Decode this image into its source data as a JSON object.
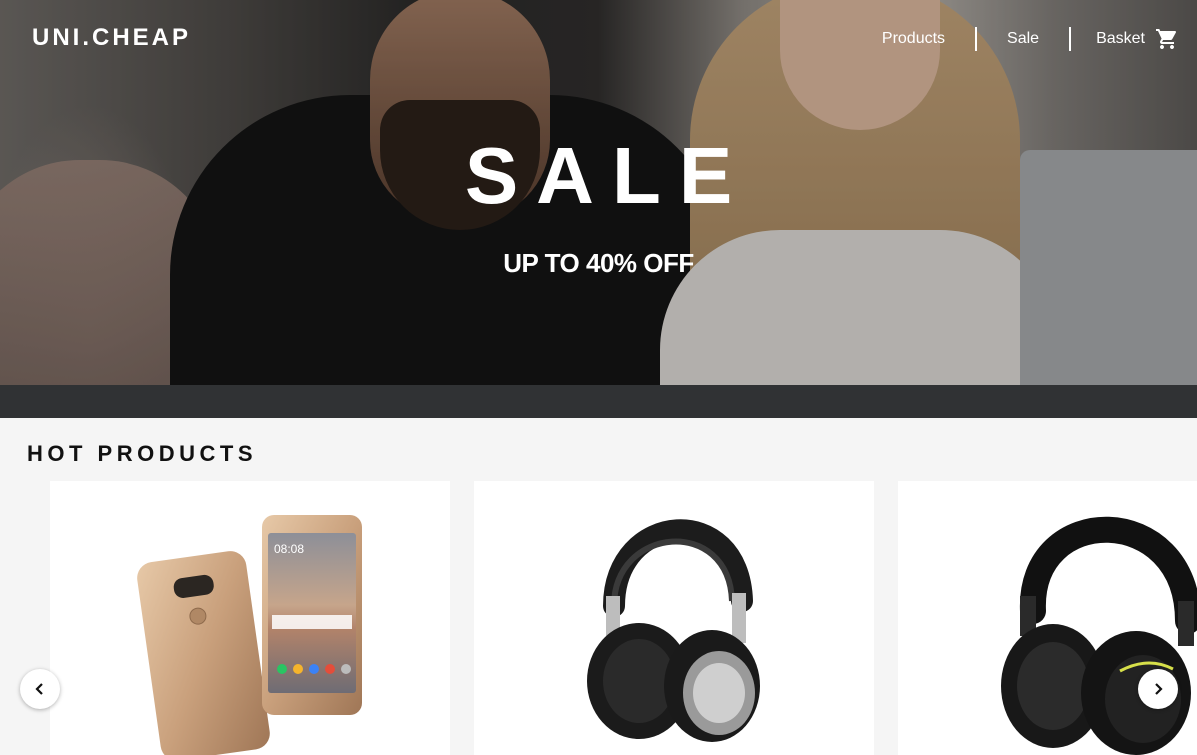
{
  "header": {
    "logo": "UNI.CHEAP",
    "nav": [
      {
        "label": "Products"
      },
      {
        "label": "Sale"
      },
      {
        "label": "Basket",
        "icon": "cart-icon"
      }
    ]
  },
  "hero": {
    "title": "SALE",
    "subtitle": "UP TO 40% OFF"
  },
  "hot_products": {
    "title": "HOT PRODUCTS",
    "items": [
      {
        "image": "smartphone",
        "icon": "phone-image"
      },
      {
        "image": "headphones",
        "icon": "headphones-image"
      },
      {
        "image": "headphones",
        "icon": "headphones-image"
      }
    ],
    "prev_icon": "chevron-left-icon",
    "next_icon": "chevron-right-icon"
  },
  "colors": {
    "background": "#f5f5f5",
    "card": "#ffffff",
    "text_dark": "#111111",
    "hero_text": "#ffffff"
  }
}
